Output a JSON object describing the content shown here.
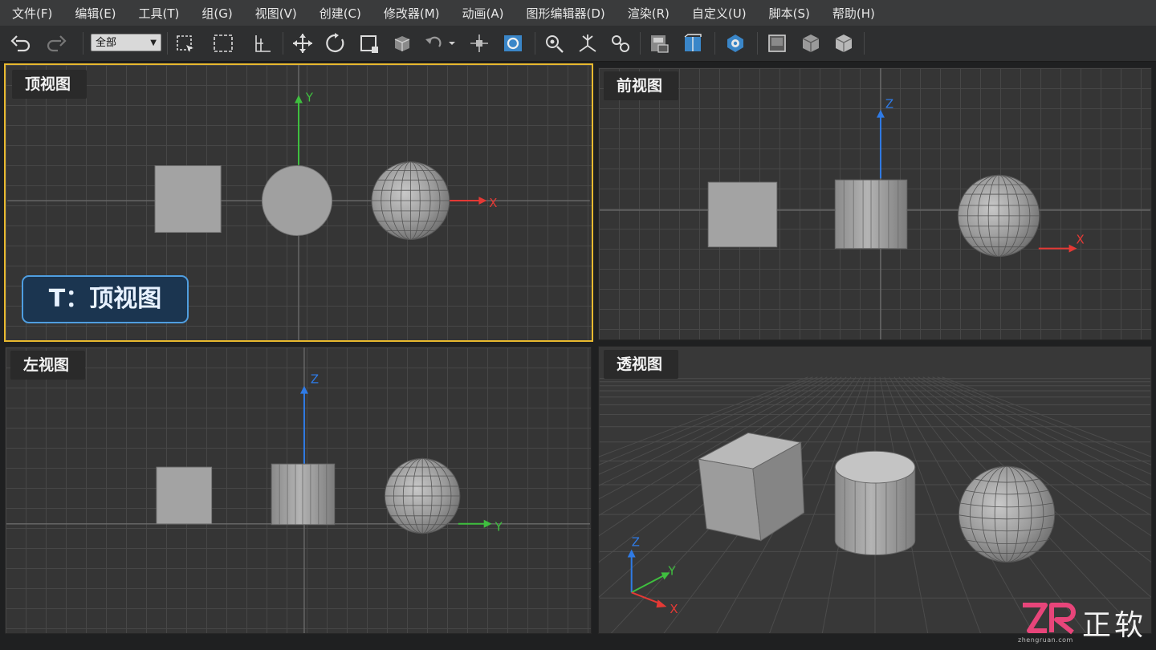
{
  "menu": [
    "文件(F)",
    "编辑(E)",
    "工具(T)",
    "组(G)",
    "视图(V)",
    "创建(C)",
    "修改器(M)",
    "动画(A)",
    "图形编辑器(D)",
    "渲染(R)",
    "自定义(U)",
    "脚本(S)",
    "帮助(H)"
  ],
  "toolbar": {
    "selection_filter": "全部",
    "icons": [
      "undo-icon",
      "redo-icon",
      "select-object-icon",
      "select-region-icon",
      "select-and-link-icon",
      "select-and-move-icon",
      "select-and-rotate-icon",
      "select-and-scale-icon",
      "select-and-place-icon",
      "use-pivot-icon",
      "snap-toggle-icon",
      "angle-snap-icon",
      "mirror-icon",
      "align-icon",
      "layer-icon",
      "schematic-view-icon",
      "material-editor-icon",
      "render-setup-icon",
      "rendered-frame-icon",
      "render-icon",
      "render-production-icon"
    ]
  },
  "viewports": {
    "top": {
      "label": "顶视图",
      "axes": [
        "Y",
        "X"
      ],
      "hint": "T：顶视图",
      "active": true
    },
    "front": {
      "label": "前视图",
      "axes": [
        "Z",
        "X"
      ]
    },
    "left": {
      "label": "左视图",
      "axes": [
        "Z",
        "Y"
      ]
    },
    "perspective": {
      "label": "透视图",
      "axes": [
        "Z",
        "Y",
        "X"
      ]
    }
  },
  "colors": {
    "active_border": "#e8b92f",
    "axis_x": "#e53935",
    "axis_y": "#3fbf3f",
    "axis_z": "#2f7be6",
    "hint_border": "#4f9ee0"
  },
  "watermark": {
    "brand": "正软",
    "url": "zhengruan.com"
  }
}
